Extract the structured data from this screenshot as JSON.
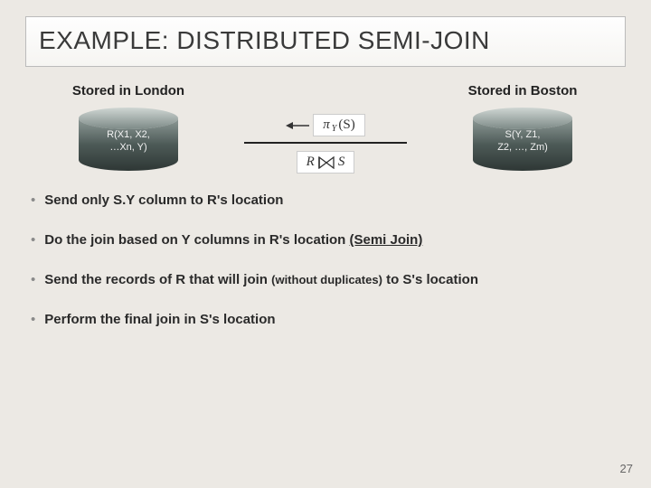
{
  "title": "EXAMPLE: DISTRIBUTED SEMI-JOIN",
  "left": {
    "location_label": "Stored in London",
    "relation_line1": "R(X1, X2,",
    "relation_line2": "…Xn, Y)"
  },
  "right": {
    "location_label": "Stored in Boston",
    "relation_line1": "S(Y, Z1,",
    "relation_line2": "Z2, …, Zm)"
  },
  "mid": {
    "projection_pi": "π",
    "projection_sub": "Y",
    "projection_arg": "(S)",
    "join_left": "R",
    "join_right": "S"
  },
  "bullets": [
    {
      "prefix": "Send only S.Y column to R's location",
      "suffix": "",
      "emph": ""
    },
    {
      "prefix": "Do the join based on Y columns in R's location ",
      "emph": "(Semi Join)",
      "suffix": ""
    },
    {
      "prefix": "Send the records of R that will join ",
      "emph": "",
      "mid_small": "(without duplicates)",
      "suffix": " to S's location"
    },
    {
      "prefix": "Perform the final join in S's location",
      "emph": "",
      "suffix": ""
    }
  ],
  "page_number": "27"
}
